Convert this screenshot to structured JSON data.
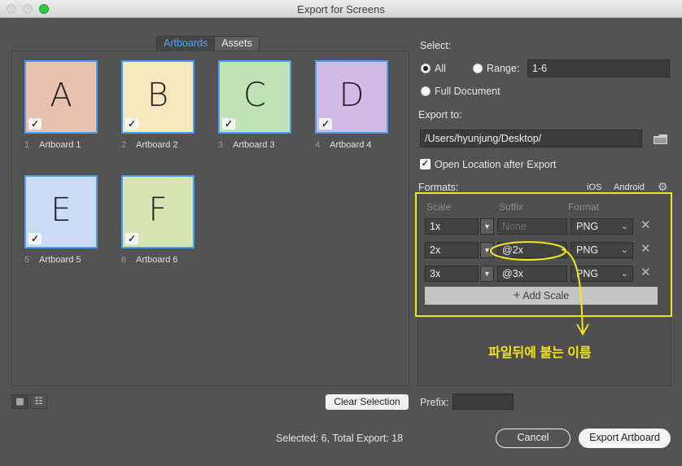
{
  "window": {
    "title": "Export for Screens"
  },
  "tabs": {
    "artboards": "Artboards",
    "assets": "Assets"
  },
  "artboards": [
    {
      "num": "1",
      "name": "Artboard 1",
      "letter": "A",
      "color": "#e8c1b0"
    },
    {
      "num": "2",
      "name": "Artboard 2",
      "letter": "B",
      "color": "#f7e8be"
    },
    {
      "num": "3",
      "name": "Artboard 3",
      "letter": "C",
      "color": "#bfe3b7"
    },
    {
      "num": "4",
      "name": "Artboard 4",
      "letter": "D",
      "color": "#d2bae6"
    },
    {
      "num": "5",
      "name": "Artboard 5",
      "letter": "E",
      "color": "#c9dcf3"
    },
    {
      "num": "6",
      "name": "Artboard 6",
      "letter": "F",
      "color": "#d8e4b3"
    }
  ],
  "bottom_left": {
    "clear_selection": "Clear Selection",
    "grid_view_icon": "grid-icon",
    "list_view_icon": "list-icon"
  },
  "select": {
    "label": "Select:",
    "all": "All",
    "range": "Range:",
    "range_value": "1-6",
    "full_document": "Full Document"
  },
  "export_to": {
    "label": "Export to:",
    "path": "/Users/hyunjung/Desktop/",
    "open_location": "Open Location after Export"
  },
  "formats": {
    "label": "Formats:",
    "ios": "iOS",
    "android": "Android",
    "col_scale": "Scale",
    "col_suffix": "Suffix",
    "col_format": "Format",
    "rows": [
      {
        "scale": "1x",
        "suffix": "",
        "suffix_placeholder": "None",
        "format": "PNG"
      },
      {
        "scale": "2x",
        "suffix": "@2x",
        "format": "PNG"
      },
      {
        "scale": "3x",
        "suffix": "@3x",
        "format": "PNG"
      }
    ],
    "add_scale": "Add Scale"
  },
  "annotation": {
    "text": "파일뒤에 붙는 이름",
    "color": "#f4e519"
  },
  "prefix": {
    "label": "Prefix:"
  },
  "status": {
    "text": "Selected: 6, Total Export: 18"
  },
  "actions": {
    "cancel": "Cancel",
    "export": "Export Artboard"
  }
}
